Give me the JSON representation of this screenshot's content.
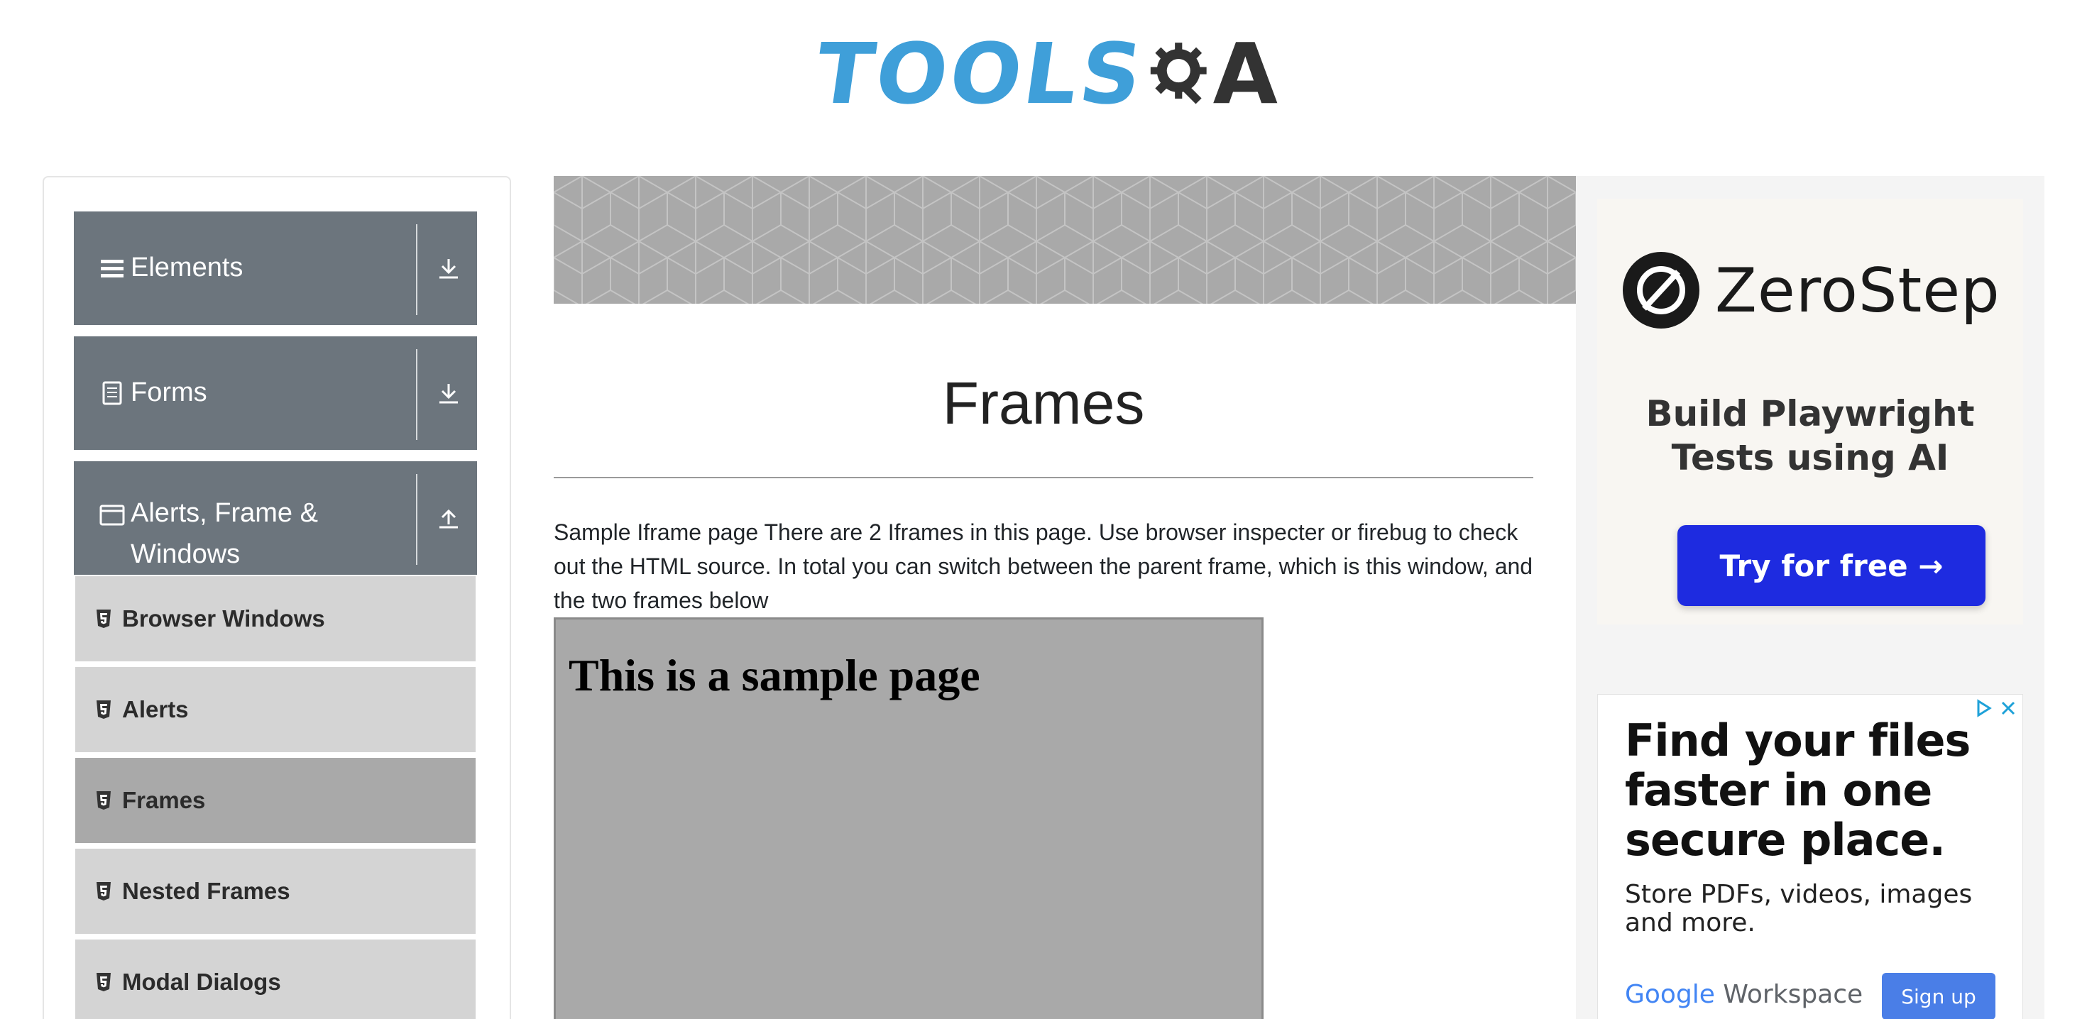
{
  "header": {
    "logo_text_tools": "TOOLS",
    "logo_text_a": "A",
    "logo_colors": {
      "tools": "#3f9fd9",
      "qa": "#333333"
    }
  },
  "sidebar": {
    "groups": [
      {
        "label": "Elements",
        "icon": "hamburger-icon",
        "toggle": "download-icon",
        "expanded": false
      },
      {
        "label": "Forms",
        "icon": "document-icon",
        "toggle": "download-icon",
        "expanded": false
      },
      {
        "label_line1": "Alerts, Frame &",
        "label_line2": "Windows",
        "icon": "window-icon",
        "toggle": "upload-icon",
        "expanded": true
      }
    ],
    "items": [
      {
        "label": "Browser Windows",
        "icon": "html5-icon",
        "active": false
      },
      {
        "label": "Alerts",
        "icon": "html5-icon",
        "active": false
      },
      {
        "label": "Frames",
        "icon": "html5-icon",
        "active": true
      },
      {
        "label": "Nested Frames",
        "icon": "html5-icon",
        "active": false
      },
      {
        "label": "Modal Dialogs",
        "icon": "html5-icon",
        "active": false
      }
    ],
    "colors": {
      "group_bg": "#6c757d",
      "item_bg": "#d4d4d4",
      "active_item_bg": "#a9a9a9"
    }
  },
  "main": {
    "title": "Frames",
    "description": "Sample Iframe page There are 2 Iframes in this page. Use browser inspecter or firebug to check out the HTML source. In total you can switch between the parent frame, which is this window, and the two frames below",
    "iframe": {
      "heading": "This is a sample page",
      "bg": "#a9a9a9"
    }
  },
  "ads": {
    "top": {
      "brand": "ZeroStep",
      "tagline_line1": "Build Playwright",
      "tagline_line2": "Tests using AI",
      "cta": "Try for free →",
      "cta_color": "#1e2be0"
    },
    "bottom": {
      "headline": "Find your files faster in one secure place.",
      "body": "Store PDFs, videos, images and more.",
      "brand_google": "Google",
      "brand_workspace": "Workspace",
      "cta": "Sign up",
      "cta_color": "#4a7ee7"
    }
  }
}
